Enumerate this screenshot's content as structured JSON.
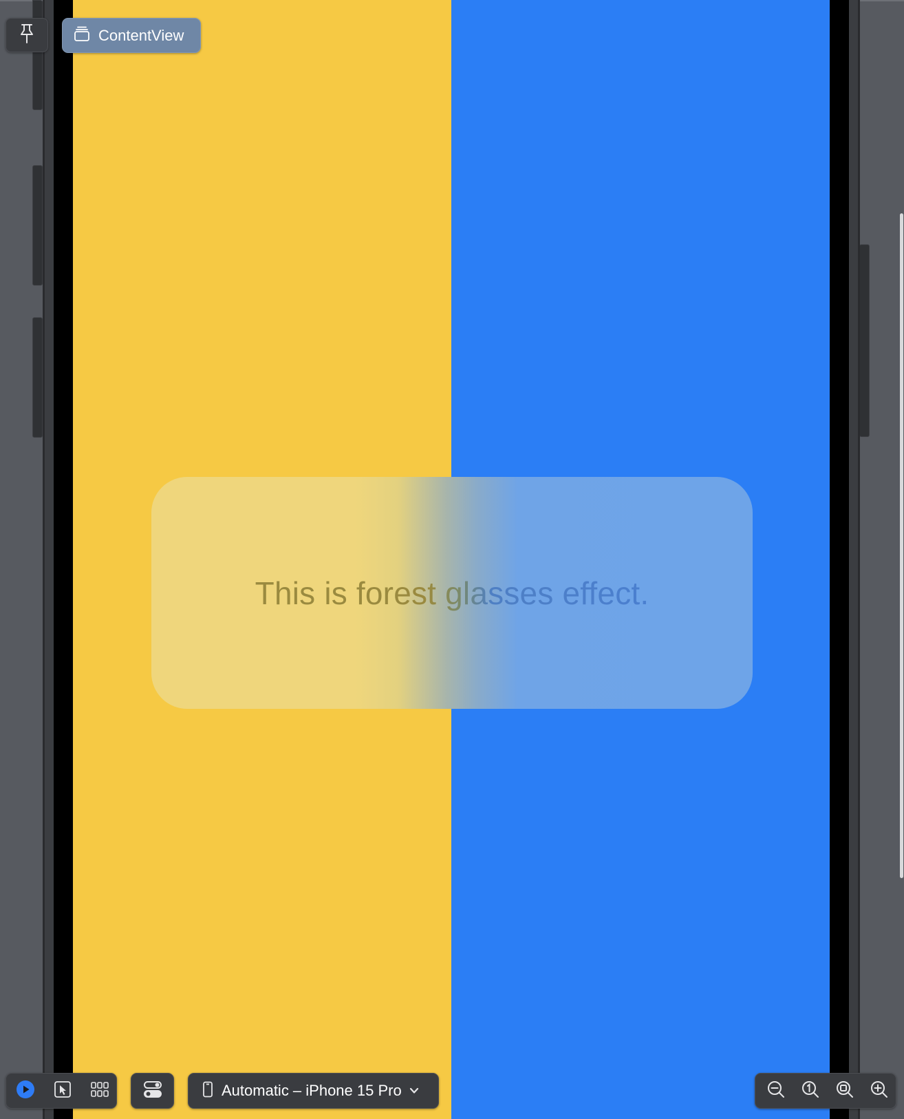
{
  "preview": {
    "title_chip": {
      "label": "ContentView"
    },
    "screen": {
      "left_color": "#f6c944",
      "right_color": "#2b7ef5",
      "card_text": "This is forest glasses effect."
    }
  },
  "icons": {
    "pin": "pin-icon",
    "content_view": "stack-window-icon",
    "live": "play-icon",
    "selectable": "pointer-icon",
    "variants": "grid-icon",
    "device_settings": "toggles-icon",
    "device": "iphone-icon",
    "dropdown": "chevron-down-icon",
    "zoom_out": "zoom-out-icon",
    "actual_size": "zoom-actual-size-icon",
    "zoom_fit": "zoom-to-fit-icon",
    "zoom_in": "zoom-in-icon"
  },
  "toolbar": {
    "device_picker": {
      "label": "Automatic – iPhone 15 Pro"
    },
    "accent_color": "#2e7cf6"
  }
}
